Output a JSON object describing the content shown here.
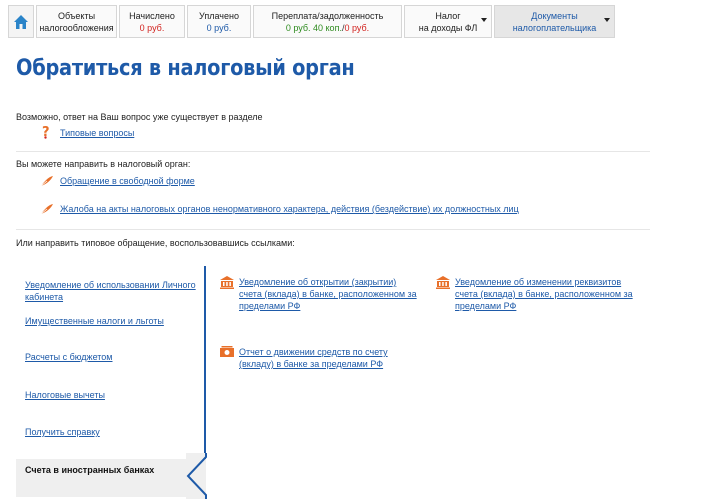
{
  "topnav": {
    "home_icon": "home-icon",
    "tabs": [
      {
        "title": "Объекты налогообложения",
        "line1": "Объекты",
        "line2": "налогообложения"
      },
      {
        "title": "Начислено",
        "value": "0 руб."
      },
      {
        "title": "Уплачено",
        "value": "0 руб."
      },
      {
        "title": "Переплата/задолженность",
        "value_green": "0 руб. 40 коп.",
        "value_sep": "/",
        "value_red": "0 руб."
      },
      {
        "line1": "Налог",
        "line2": "на доходы ФЛ"
      },
      {
        "line1": "Документы",
        "line2": "налогоплательщика"
      }
    ]
  },
  "page_title": "Обратиться в налоговый орган",
  "faq": {
    "intro": "Возможно, ответ на Ваш вопрос уже существует в разделе",
    "link": "Типовые вопросы",
    "icon": "question-icon"
  },
  "send": {
    "intro": "Вы можете направить в налоговый орган:",
    "links": [
      {
        "label": "Обращение в свободной форме",
        "icon": "quill-icon"
      },
      {
        "label": "Жалоба на акты налоговых органов ненормативного характера, действия (бездействие) их должностных лиц",
        "icon": "quill-icon"
      }
    ]
  },
  "typical": {
    "intro": "Или направить типовое обращение, воспользовавшись ссылками:",
    "categories": [
      "Уведомление об использовании Личного кабинета",
      "Имущественные налоги и льготы",
      "Расчеты с бюджетом",
      "Налоговые вычеты",
      "Получить справку",
      "Счета в иностранных банках"
    ],
    "category_line1": "Уведомление об использовании Личного",
    "category_line2": "кабинета",
    "active_category": "Счета в иностранных банках",
    "forms": [
      {
        "line1": "Уведомление об открытии (закрытии)",
        "line2": "счета (вклада) в банке, расположенном за",
        "line3": "пределами РФ",
        "icon": "bank-icon"
      },
      {
        "line1": "Уведомление об изменении реквизитов",
        "line2": "счета (вклада) в банке, расположенном за",
        "line3": "пределами РФ",
        "icon": "bank-icon"
      },
      {
        "line1": "Отчет о движении средств по счету",
        "line2": "(вкладу) в банке за пределами РФ",
        "icon": "money-icon"
      }
    ]
  },
  "colors": {
    "accent": "#1e5aa8",
    "icon_orange": "#e8702a",
    "positive": "#2e8b1f",
    "negative": "#d2231f"
  }
}
